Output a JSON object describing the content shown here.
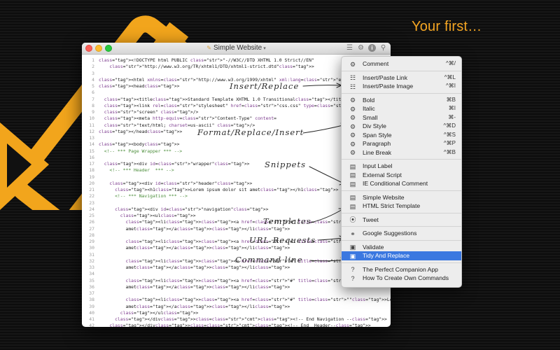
{
  "tagline": "Your first…",
  "window": {
    "title": "Simple Website",
    "toolbar_icons": [
      "lines-icon",
      "gear-icon",
      "info-icon",
      "pin-icon"
    ]
  },
  "code": {
    "lines": [
      {
        "n": "1",
        "t": "<!DOCTYPE html PUBLIC \"-//W3C//DTD XHTML 1.0 Strict//EN\""
      },
      {
        "n": "2",
        "t": "    \"http://www.w3.org/TR/xhtml1/DTD/xhtml1-strict.dtd\">"
      },
      {
        "n": "3",
        "t": ""
      },
      {
        "n": "4",
        "t": "<html xmlns=\"http://www.w3.org/1999/xhtml\" xml:lang=\"en\" lang=\"en\">"
      },
      {
        "n": "5",
        "t": "<head>"
      },
      {
        "n": "6",
        "t": ""
      },
      {
        "n": "7",
        "t": "  <title>Standard Template XHTML 1.0 Transitional</title>"
      },
      {
        "n": "8",
        "t": "  <link rel=\"stylesheet\" href=\"css.css\" type=\"text/css\" media="
      },
      {
        "n": "9",
        "t": "  \"screen\" />"
      },
      {
        "n": "10",
        "t": "  <meta http-equiv=\"Content-Type\" content="
      },
      {
        "n": "11",
        "t": "  \"text/html; charset=us-ascii\" />"
      },
      {
        "n": "12",
        "t": "</head>"
      },
      {
        "n": "13",
        "t": ""
      },
      {
        "n": "14",
        "t": "<body>"
      },
      {
        "n": "15",
        "t": "  <!-- *** Page Wrapper *** -->"
      },
      {
        "n": "16",
        "t": ""
      },
      {
        "n": "17",
        "t": "  <div id=\"wrapper\">"
      },
      {
        "n": "18",
        "t": "    <!-- *** Header  *** -->"
      },
      {
        "n": "19",
        "t": ""
      },
      {
        "n": "20",
        "t": "    <div id=\"header\">"
      },
      {
        "n": "21",
        "t": "      <h1>Lorem ipsum dolor sit amet</h1>"
      },
      {
        "n": "22",
        "t": "      <!-- *** Navigation *** -->"
      },
      {
        "n": "23",
        "t": ""
      },
      {
        "n": "24",
        "t": "      <div id=\"navigation\">"
      },
      {
        "n": "25",
        "t": "        <ul>"
      },
      {
        "n": "26",
        "t": "          <li><a href=\"#\" title=\"\">Lorem ipsum dolor sit"
      },
      {
        "n": "27",
        "t": "          amet</a></li>"
      },
      {
        "n": "28",
        "t": ""
      },
      {
        "n": "29",
        "t": "          <li><a href=\"#\" title=\"\">Lorem ipsum dolor sit"
      },
      {
        "n": "30",
        "t": "          amet</a></li>"
      },
      {
        "n": "31",
        "t": ""
      },
      {
        "n": "32",
        "t": "          <li><a href=\"#\" title=\"\">Lorem ipsum dolor sit"
      },
      {
        "n": "33",
        "t": "          amet</a></li>"
      },
      {
        "n": "34",
        "t": ""
      },
      {
        "n": "35",
        "t": "          <li><a href=\"#\" title=\"\">Lorem ipsum dolor sit"
      },
      {
        "n": "36",
        "t": "          amet</a></li>"
      },
      {
        "n": "37",
        "t": ""
      },
      {
        "n": "38",
        "t": "          <li><a href=\"#\" title=\"\">Lorem ipsum dolor sit"
      },
      {
        "n": "39",
        "t": "          amet</a></li>"
      },
      {
        "n": "40",
        "t": "        </ul>"
      },
      {
        "n": "41",
        "t": "      </div><!-- End Navigation -->"
      },
      {
        "n": "42",
        "t": "    </div><!-- End  Header-->"
      },
      {
        "n": "43",
        "t": "    <!-- *** Content *** -->"
      },
      {
        "n": "44",
        "t": ""
      }
    ]
  },
  "menu": {
    "groups": [
      [
        {
          "label": "Comment",
          "shortcut": "^⌘/",
          "icon": "gear-icon"
        }
      ],
      [
        {
          "label": "Insert/Paste Link",
          "shortcut": "^⌘L",
          "icon": "clipboard-icon"
        },
        {
          "label": "Insert/Paste Image",
          "shortcut": "^⌘I",
          "icon": "clipboard-icon"
        }
      ],
      [
        {
          "label": "Bold",
          "shortcut": "⌘B",
          "icon": "gear-icon"
        },
        {
          "label": "Italic",
          "shortcut": "⌘I",
          "icon": "gear-icon"
        },
        {
          "label": "Small",
          "shortcut": "⌘-",
          "icon": "gear-icon"
        },
        {
          "label": "Div Style",
          "shortcut": "^⌘D",
          "icon": "gear-icon"
        },
        {
          "label": "Span Style",
          "shortcut": "^⌘S",
          "icon": "gear-icon"
        },
        {
          "label": "Paragraph",
          "shortcut": "^⌘P",
          "icon": "gear-icon"
        },
        {
          "label": "Line Break",
          "shortcut": "^⌘B",
          "icon": "gear-icon"
        }
      ],
      [
        {
          "label": "Input Label",
          "shortcut": "",
          "icon": "document-icon"
        },
        {
          "label": "External Script",
          "shortcut": "",
          "icon": "document-icon"
        },
        {
          "label": "IE Conditional Comment",
          "shortcut": "",
          "icon": "document-icon"
        }
      ],
      [
        {
          "label": "Simple Website",
          "shortcut": "",
          "icon": "document-icon"
        },
        {
          "label": "HTML Strict Template",
          "shortcut": "",
          "icon": "document-icon"
        }
      ],
      [
        {
          "label": "Tweet",
          "shortcut": "",
          "icon": "compass-icon"
        }
      ],
      [
        {
          "label": "Google Suggestions",
          "shortcut": "",
          "icon": "link-icon"
        }
      ],
      [
        {
          "label": "Validate",
          "shortcut": "",
          "icon": "terminal-icon"
        },
        {
          "label": "Tidy And Replace",
          "shortcut": "",
          "icon": "terminal-icon",
          "highlighted": true
        }
      ],
      [
        {
          "label": "The Perfect Companion App",
          "shortcut": "",
          "icon": "question-icon"
        },
        {
          "label": "How To Create Own Commands",
          "shortcut": "",
          "icon": "question-icon"
        }
      ]
    ],
    "highlight_color": "#3b78e0"
  },
  "annotations": {
    "insert_replace": "Insert/Replace",
    "format_replace_insert": "Format/Replace/Insert",
    "snippets": "Snippets",
    "templates": "Templates",
    "url_requests": "URL  Requests",
    "command_line": "Command  line"
  },
  "colors": {
    "tagline": "#f5a623",
    "logo": "#f2a51c",
    "background": "#111111"
  }
}
